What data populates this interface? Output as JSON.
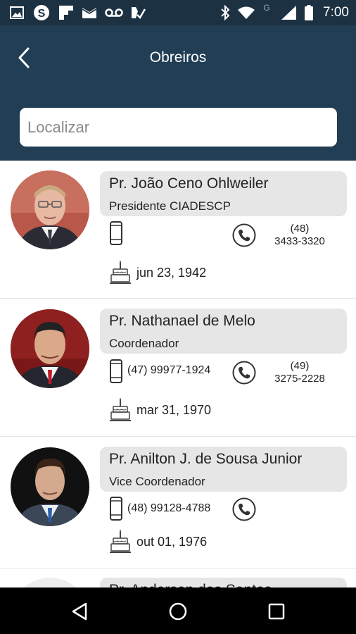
{
  "status_bar": {
    "time": "7:00",
    "network_label": "G",
    "icons": [
      "image-icon",
      "skype-icon",
      "flipboard-icon",
      "mail-icon",
      "voicemail-icon",
      "tasks-icon",
      "bluetooth-icon",
      "wifi-icon",
      "signal-icon",
      "battery-icon"
    ]
  },
  "header": {
    "title": "Obreiros",
    "back_icon": "back-arrow-icon"
  },
  "search": {
    "placeholder": "Localizar",
    "value": ""
  },
  "contacts": [
    {
      "name": "Pr. João Ceno Ohlweiler",
      "role": "Presidente CIADESCP",
      "mobile": "",
      "landline_area": "(48)",
      "landline_number": "3433-3320",
      "birthday": "jun 23, 1942"
    },
    {
      "name": "Pr. Nathanael de Melo",
      "role": "Coordenador",
      "mobile": "(47) 99977-1924",
      "landline_area": "(49)",
      "landline_number": "3275-2228",
      "birthday": "mar 31, 1970"
    },
    {
      "name": "Pr. Anilton J. de Sousa Junior",
      "role": "Vice Coordenador",
      "mobile": "(48) 99128-4788",
      "landline_area": "",
      "landline_number": "",
      "birthday": "out 01, 1976"
    },
    {
      "name": "Pr. Anderson dos Santos",
      "role": "",
      "mobile": "",
      "landline_area": "",
      "landline_number": "",
      "birthday": ""
    }
  ],
  "nav": {
    "back_icon": "nav-back-icon",
    "home_icon": "nav-home-icon",
    "recents_icon": "nav-recents-icon"
  },
  "colors": {
    "status_bar": "#1c3142",
    "app_bar": "#213e55",
    "name_box": "#e6e6e6",
    "text": "#222222"
  }
}
